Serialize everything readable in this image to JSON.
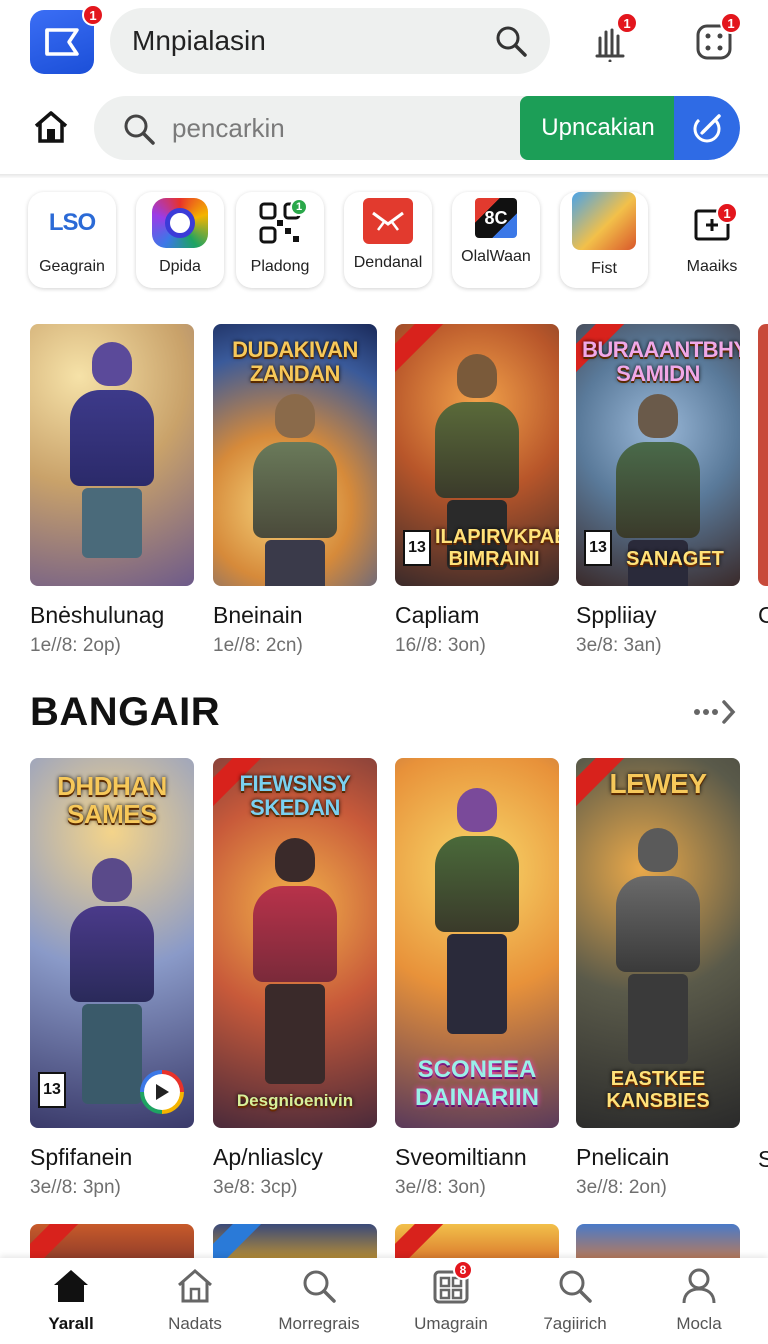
{
  "header": {
    "logo_badge": "1",
    "search_text": "Mnpialasin",
    "notif_badge": "1",
    "apps_badge": "1"
  },
  "search_bar": {
    "placeholder": "pencarkin",
    "upload_label": "Upncakian"
  },
  "shortcuts": [
    {
      "label": "Geagrain",
      "icon": "lso-icon",
      "icon_text": "LSO"
    },
    {
      "label": "Dpida",
      "icon": "ring-icon"
    },
    {
      "label": "Pladong",
      "icon": "qr-icon",
      "badge": "1"
    },
    {
      "label": "Dendanal",
      "icon": "envelope-icon"
    },
    {
      "label": "OlalWaan",
      "icon": "media-icon"
    },
    {
      "label": "Fist",
      "icon": "game-art-icon"
    },
    {
      "label": "Maaiks",
      "icon": "add-box-icon",
      "badge": "1"
    }
  ],
  "row1": [
    {
      "name": "Bnėshulunag",
      "meta": "1e//8: 2op)",
      "cover_title": "",
      "cover_bottom": ""
    },
    {
      "name": "Bneinain",
      "meta": "1e//8: 2cn)",
      "cover_title": "DUDAKIVAN ZANDAN",
      "cover_bottom": ""
    },
    {
      "name": "Capliam",
      "meta": "16//8: 3on)",
      "cover_title": "",
      "cover_bottom": "ILAPIRVKPAES BIMRAINI",
      "rating": "13"
    },
    {
      "name": "Sppliiay",
      "meta": "3e/8: 3an)",
      "cover_title": "BURAAANTBHY SAMIDN",
      "cover_bottom": "SANAGET",
      "rating": "13"
    }
  ],
  "row1_peek": {
    "name": "C"
  },
  "section": {
    "title": "BANGAIR"
  },
  "row2": [
    {
      "name": "Spfifanein",
      "meta": "3e//8: 3pn)",
      "cover_title": "DHDHAN SAMES",
      "cover_bottom": "",
      "rating": "13"
    },
    {
      "name": "Ap/nliaslcy",
      "meta": "3e/8: 3cp)",
      "cover_title": "FIEWSNSY SKEDAN",
      "cover_bottom": "Desgnioenivin"
    },
    {
      "name": "Sveomiltiann",
      "meta": "3e//8: 3on)",
      "cover_title": "",
      "cover_bottom": "SCONEEA DAINARIIN"
    },
    {
      "name": "Pnelicain",
      "meta": "3e//8: 2on)",
      "cover_title": "LEWEY",
      "cover_bottom": "EASTKEE KANSBIES"
    }
  ],
  "row2_peek": {
    "name": "S"
  },
  "nav": [
    {
      "label": "Yarall",
      "icon": "home-icon",
      "active": true
    },
    {
      "label": "Nadats",
      "icon": "home-outline-icon"
    },
    {
      "label": "Morregrais",
      "icon": "search-icon"
    },
    {
      "label": "Umagrain",
      "icon": "grid-icon",
      "badge": "8"
    },
    {
      "label": "7agiirich",
      "icon": "search-icon"
    },
    {
      "label": "Mocla",
      "icon": "person-icon"
    }
  ],
  "colors": {
    "accent_blue": "#2f6be5",
    "upload_green": "#1c9e57",
    "badge_red": "#e3161d"
  }
}
